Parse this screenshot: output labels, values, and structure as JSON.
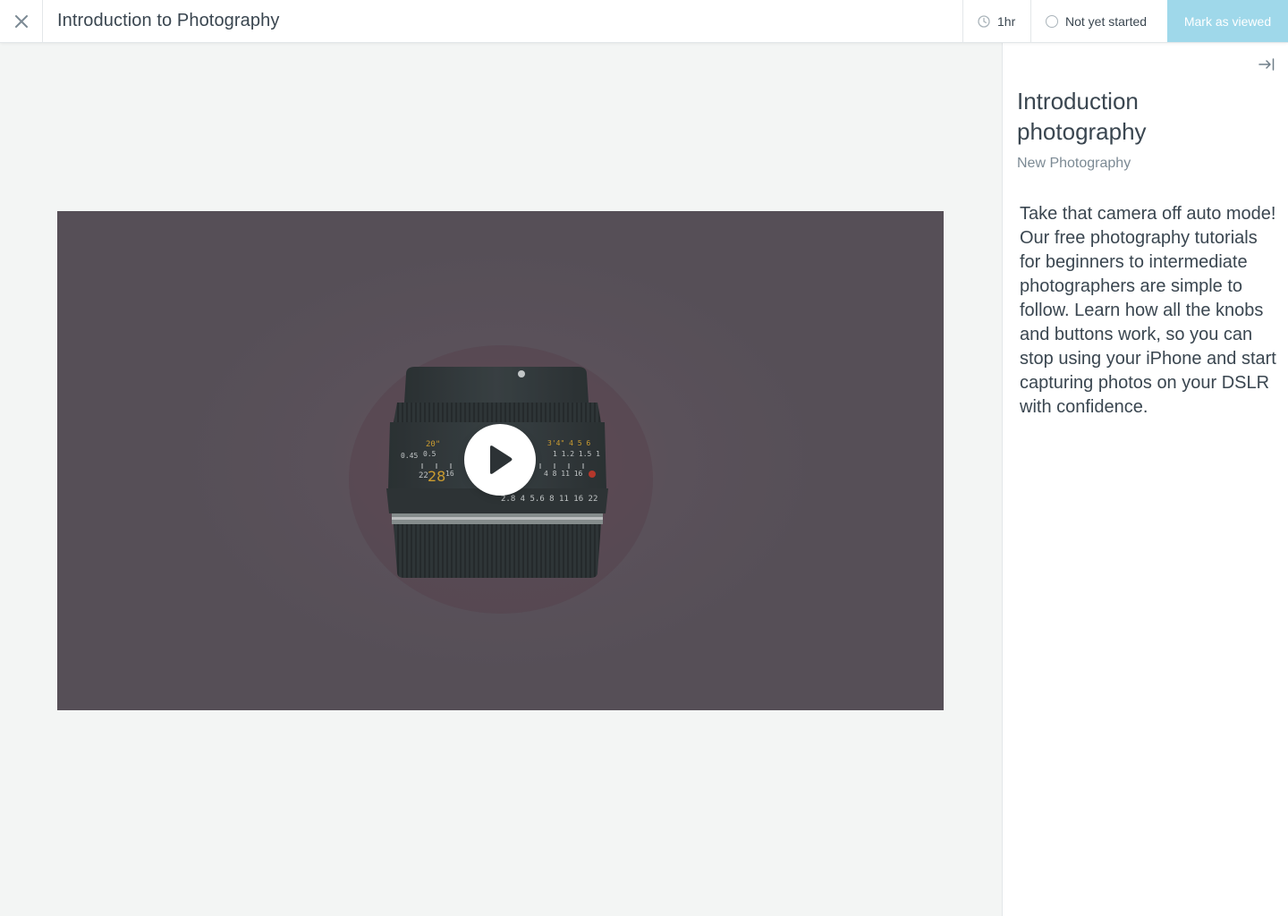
{
  "header": {
    "title": "Introduction to Photography",
    "duration": "1hr",
    "status": "Not yet started",
    "mark_viewed_label": "Mark as viewed"
  },
  "video": {
    "lens_markings": {
      "top_left": "20\"",
      "left_a": "0.45",
      "left_b": "0.5",
      "focal": "28",
      "left_c": "22",
      "left_d": "16",
      "right_top": "3'4\"  4  5  6",
      "right_mid": "1   1.2  1.5  1",
      "right_low": "4   8  11  16",
      "aperture": "2.8  4  5.6  8  11  16  22"
    }
  },
  "side": {
    "title": "Introduction photography",
    "subtitle": "New Photography",
    "description": "Take that camera off auto mode! Our free photography tutorials for beginners to intermediate photographers are simple to follow. Learn how all the knobs and buttons work, so you can stop using your iPhone and start capturing photos on your DSLR with confidence."
  },
  "icons": {
    "close": "close-icon",
    "clock": "clock-icon",
    "status": "circle-icon",
    "play": "play-icon",
    "collapse": "collapse-right-icon"
  },
  "colors": {
    "accent": "#9fd8ea",
    "text": "#3a4650",
    "muted": "#7c8a94",
    "background": "#f3f5f4"
  }
}
